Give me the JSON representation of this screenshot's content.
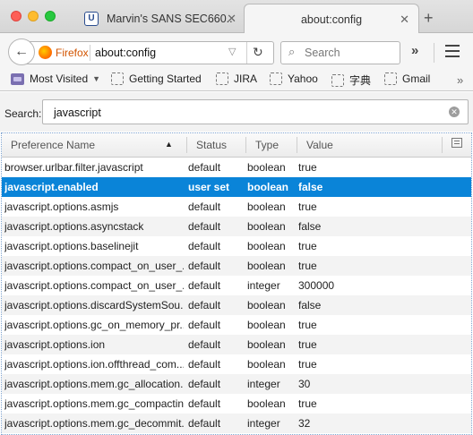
{
  "tabs": [
    {
      "title": "Marvin's SANS SEC660...",
      "favicon": "U",
      "active": false
    },
    {
      "title": "about:config",
      "active": true
    }
  ],
  "navbar": {
    "identity_label": "Firefox",
    "url": "about:config",
    "search_placeholder": "Search"
  },
  "bookmarks": [
    {
      "label": "Most Visited",
      "icon": "most-visited-icon",
      "has_dropdown": true
    },
    {
      "label": "Getting Started",
      "icon": "bookmark-icon"
    },
    {
      "label": "JIRA",
      "icon": "bookmark-icon"
    },
    {
      "label": "Yahoo",
      "icon": "bookmark-icon"
    },
    {
      "label": "字典",
      "icon": "bookmark-icon"
    },
    {
      "label": "Gmail",
      "icon": "bookmark-icon"
    }
  ],
  "config": {
    "search_label": "Search:",
    "search_value": "javascript",
    "columns": {
      "name": "Preference Name",
      "status": "Status",
      "type": "Type",
      "value": "Value"
    },
    "rows": [
      {
        "name": "browser.urlbar.filter.javascript",
        "status": "default",
        "type": "boolean",
        "value": "true"
      },
      {
        "name": "javascript.enabled",
        "status": "user set",
        "type": "boolean",
        "value": "false",
        "selected": true
      },
      {
        "name": "javascript.options.asmjs",
        "status": "default",
        "type": "boolean",
        "value": "true"
      },
      {
        "name": "javascript.options.asyncstack",
        "status": "default",
        "type": "boolean",
        "value": "false"
      },
      {
        "name": "javascript.options.baselinejit",
        "status": "default",
        "type": "boolean",
        "value": "true"
      },
      {
        "name": "javascript.options.compact_on_user_...",
        "status": "default",
        "type": "boolean",
        "value": "true"
      },
      {
        "name": "javascript.options.compact_on_user_...",
        "status": "default",
        "type": "integer",
        "value": "300000"
      },
      {
        "name": "javascript.options.discardSystemSou...",
        "status": "default",
        "type": "boolean",
        "value": "false"
      },
      {
        "name": "javascript.options.gc_on_memory_pr...",
        "status": "default",
        "type": "boolean",
        "value": "true"
      },
      {
        "name": "javascript.options.ion",
        "status": "default",
        "type": "boolean",
        "value": "true"
      },
      {
        "name": "javascript.options.ion.offthread_com...",
        "status": "default",
        "type": "boolean",
        "value": "true"
      },
      {
        "name": "javascript.options.mem.gc_allocation...",
        "status": "default",
        "type": "integer",
        "value": "30"
      },
      {
        "name": "javascript.options.mem.gc_compacting",
        "status": "default",
        "type": "boolean",
        "value": "true"
      },
      {
        "name": "javascript.options.mem.gc_decommit...",
        "status": "default",
        "type": "integer",
        "value": "32"
      }
    ]
  },
  "colors": {
    "selection": "#0a84d8",
    "accent_firefox": "#d25400"
  }
}
